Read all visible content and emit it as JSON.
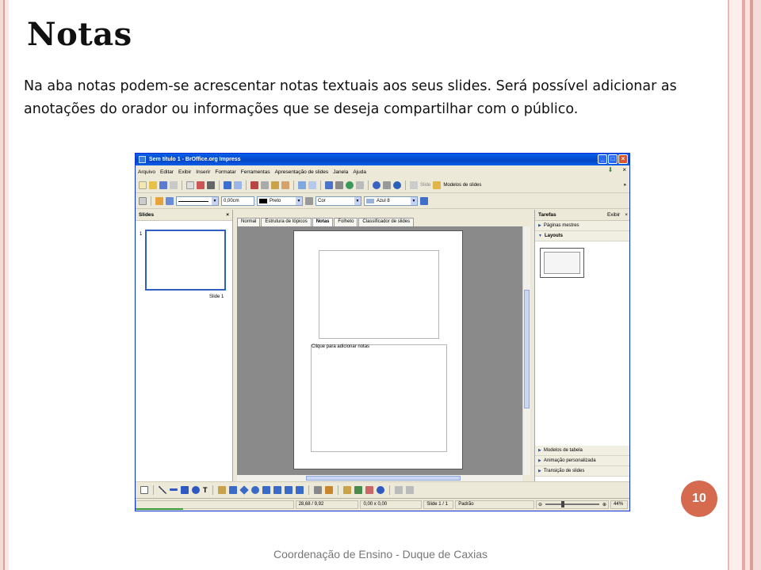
{
  "slide": {
    "title": "Notas",
    "description": "Na aba notas podem-se acrescentar notas textuais aos seus slides. Será possível adicionar as anotações do orador ou informações que se deseja compartilhar com  o público.",
    "footer": "Coordenação de Ensino - Duque de Caxias",
    "page_number": "10"
  },
  "colors": {
    "accent": "#d56a4f",
    "titlebar": "#0a5fe8",
    "selection": "#2f5fc2"
  },
  "window": {
    "title": "Sem título 1 - BrOffice.org Impress",
    "controls": [
      "_",
      "□",
      "×"
    ]
  },
  "menu": {
    "items": [
      "Arquivo",
      "Editar",
      "Exibir",
      "Inserir",
      "Formatar",
      "Ferramentas",
      "Apresentação de slides",
      "Janela",
      "Ajuda"
    ],
    "close": "×"
  },
  "toolbar": {
    "slide_label": "Slide",
    "models_label": "Modelos de slides",
    "more": "»"
  },
  "format_bar": {
    "line_width": "0,00cm",
    "line_color": "Preto",
    "fill_type": "Cor",
    "fill_color": "Azul 8"
  },
  "slides_pane": {
    "title": "Slides",
    "close": "×",
    "thumb_number": "1",
    "thumb_label": "Slide 1"
  },
  "view_tabs": [
    "Normal",
    "Estrutura de tópicos",
    "Notas",
    "Folheto",
    "Classificador de slides"
  ],
  "active_tab": "Notas",
  "notes_placeholder": "Clique para adicionar notas",
  "tasks_pane": {
    "title": "Tarefas",
    "view": "Exibir",
    "close": "×",
    "sections_top": [
      "Páginas mestres",
      "Layouts"
    ],
    "sections_bottom": [
      "Modelos de tabela",
      "Animação personalizada",
      "Transição de slides"
    ]
  },
  "status": {
    "position": "28,68 / 9,92",
    "size": "0,00 x 0,00",
    "slide": "Slide 1 / 1",
    "master": "Padrão",
    "zoom": "44%",
    "zoom_fraction": 0.3
  }
}
